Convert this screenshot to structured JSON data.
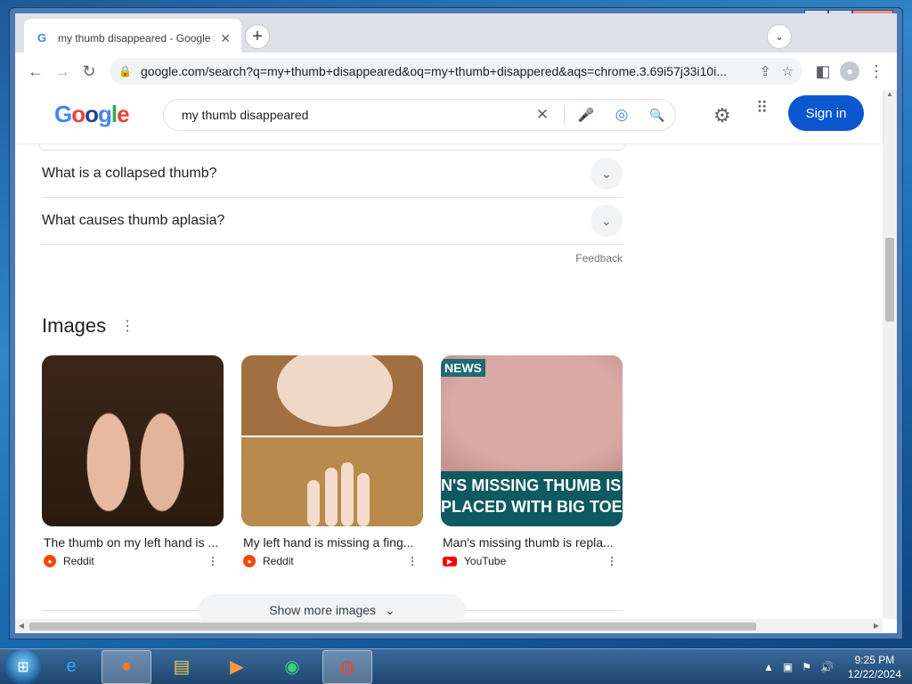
{
  "window": {
    "min": "▁",
    "max": "□",
    "close": "✕"
  },
  "tab": {
    "title": "my thumb disappeared - Google Search",
    "favicon": "G",
    "close": "✕"
  },
  "newtab": "+",
  "tabsearch": "⌄",
  "toolbar": {
    "back": "←",
    "forward": "→",
    "reload": "↻",
    "url": "google.com/search?q=my+thumb+disappeared&oq=my+thumb+disappered&aqs=chrome.3.69i57j33i10i...",
    "share": "⇪",
    "star": "☆",
    "sidepanel": "◧",
    "menu": "⋮"
  },
  "google": {
    "logo": [
      "G",
      "o",
      "o",
      "g",
      "l",
      "e"
    ],
    "query": "my thumb disappeared",
    "clear": "✕",
    "mic": "🎤",
    "lens": "◎",
    "search": "🔍",
    "settings": "⚙",
    "apps": "⠿",
    "signin": "Sign in"
  },
  "paa": [
    {
      "q": "What is a collapsed thumb?"
    },
    {
      "q": "What causes thumb aplasia?"
    }
  ],
  "feedback": "Feedback",
  "images": {
    "title": "Images",
    "cards": [
      {
        "title": "The thumb on my left hand is ...",
        "source": "Reddit"
      },
      {
        "title": "My left hand is missing a fing...",
        "source": "Reddit"
      },
      {
        "title": "Man's missing thumb is repla...",
        "source": "YouTube",
        "badge": "NEWS",
        "caption1": "N'S MISSING THUMB IS",
        "caption2": "PLACED WITH BIG TOE"
      }
    ],
    "show_more": "Show more images"
  },
  "taskbar": {
    "time": "9:25 PM",
    "date": "12/22/2024"
  },
  "colors": {
    "signin": "#0b57d0",
    "reddit": "#ff4500",
    "youtube": "#ff0000"
  }
}
